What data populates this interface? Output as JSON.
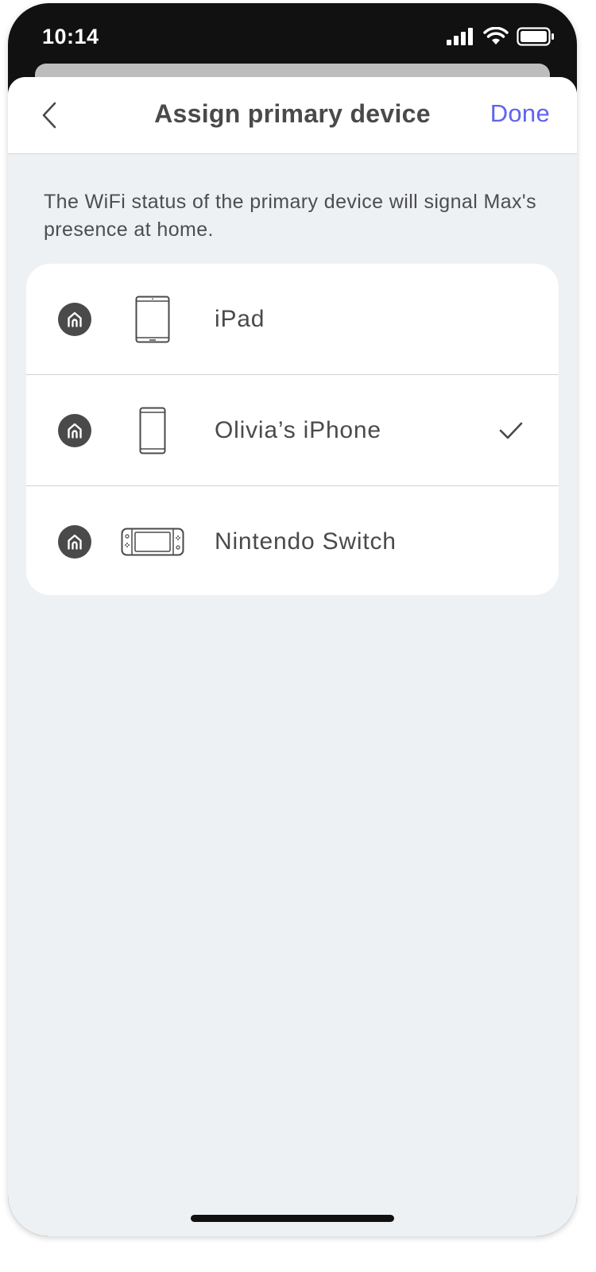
{
  "status_bar": {
    "time": "10:14",
    "icons": [
      "cellular-signal-icon",
      "wifi-icon",
      "battery-icon"
    ]
  },
  "nav": {
    "back_icon": "chevron-left-icon",
    "title": "Assign primary device",
    "done_label": "Done"
  },
  "description": "The WiFi status of the primary device will signal Max's presence at home.",
  "devices": [
    {
      "label": "iPad",
      "icon": "tablet-icon",
      "selected": false
    },
    {
      "label": "Olivia’s iPhone",
      "icon": "smartphone-icon",
      "selected": true
    },
    {
      "label": "Nintendo Switch",
      "icon": "game-console-icon",
      "selected": false
    }
  ],
  "colors": {
    "accent": "#5f63f0",
    "text": "#4a4a4a",
    "sheet_background": "#eef1f4",
    "card_background": "#ffffff"
  }
}
